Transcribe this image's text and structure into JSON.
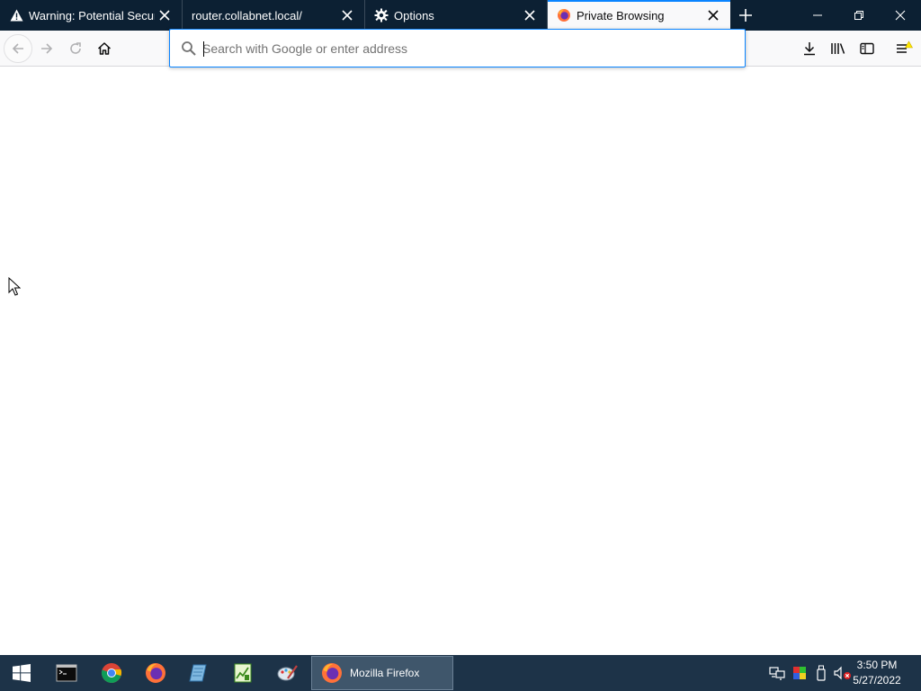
{
  "tabs": [
    {
      "label": "Warning: Potential Security Risk Ahead",
      "icon": "warning-icon",
      "selected": false
    },
    {
      "label": "router.collabnet.local/",
      "icon": "",
      "selected": false
    },
    {
      "label": "Options",
      "icon": "gear-icon",
      "selected": false
    },
    {
      "label": "Private Browsing",
      "icon": "firefox-icon",
      "selected": true
    }
  ],
  "urlbar": {
    "placeholder": "Search with Google or enter address",
    "value": ""
  },
  "taskbar": {
    "active_app_label": "Mozilla Firefox",
    "time": "3:50 PM",
    "date": "5/27/2022"
  },
  "colors": {
    "tabstrip": "#0c2033",
    "accent": "#0a84ff",
    "taskbar": "#1d3348"
  }
}
